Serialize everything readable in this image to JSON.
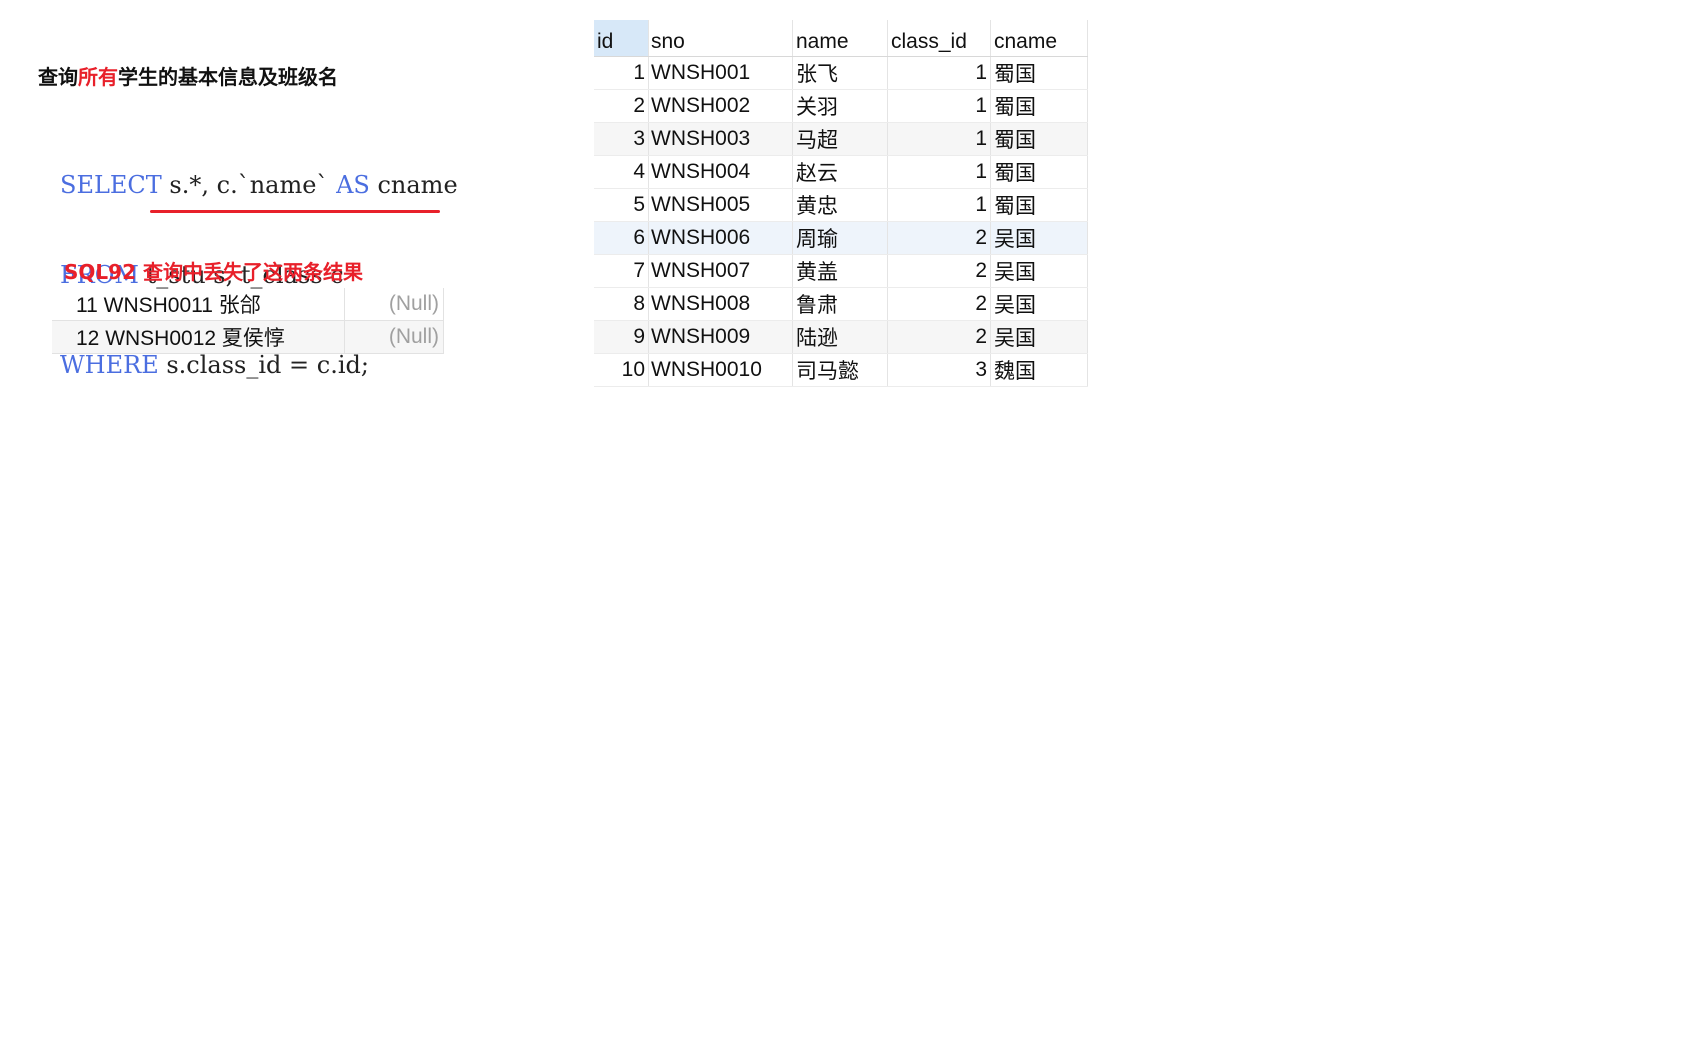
{
  "heading": {
    "prefix": "查询",
    "accent": "所有",
    "suffix": "学生的基本信息及班级名"
  },
  "sql": {
    "line1": {
      "kw": "SELECT",
      "rest": " s.*, c.`name` ",
      "kw2": "AS",
      "rest2": " cname"
    },
    "line2": {
      "kw": "FROM",
      "rest": " t_stu s, t_class c"
    },
    "line3": {
      "kw": "WHERE",
      "rest": " s.class_id = c.id;"
    }
  },
  "colors": {
    "accent_red": "#e8202a",
    "sql_keyword": "#4b6ee0",
    "selected_header": "#d7e8f8",
    "null_text": "#a0a0a0"
  },
  "note": "SQL92 查询中丢失了这两条结果",
  "lost_rows": [
    {
      "main": "11 WNSH0011 张郃",
      "null": "(Null)"
    },
    {
      "main": "12 WNSH0012 夏侯惇",
      "null": "(Null)"
    }
  ],
  "result_grid": {
    "columns": [
      "id",
      "sno",
      "name",
      "class_id",
      "cname"
    ],
    "rows": [
      {
        "id": "1",
        "sno": "WNSH001",
        "name": "张飞",
        "class_id": "1",
        "cname": "蜀国"
      },
      {
        "id": "2",
        "sno": "WNSH002",
        "name": "关羽",
        "class_id": "1",
        "cname": "蜀国"
      },
      {
        "id": "3",
        "sno": "WNSH003",
        "name": "马超",
        "class_id": "1",
        "cname": "蜀国"
      },
      {
        "id": "4",
        "sno": "WNSH004",
        "name": "赵云",
        "class_id": "1",
        "cname": "蜀国"
      },
      {
        "id": "5",
        "sno": "WNSH005",
        "name": "黄忠",
        "class_id": "1",
        "cname": "蜀国"
      },
      {
        "id": "6",
        "sno": "WNSH006",
        "name": "周瑜",
        "class_id": "2",
        "cname": "吴国"
      },
      {
        "id": "7",
        "sno": "WNSH007",
        "name": "黄盖",
        "class_id": "2",
        "cname": "吴国"
      },
      {
        "id": "8",
        "sno": "WNSH008",
        "name": "鲁肃",
        "class_id": "2",
        "cname": "吴国"
      },
      {
        "id": "9",
        "sno": "WNSH009",
        "name": "陆逊",
        "class_id": "2",
        "cname": "吴国"
      },
      {
        "id": "10",
        "sno": "WNSH0010",
        "name": "司马懿",
        "class_id": "3",
        "cname": "魏国"
      }
    ]
  }
}
